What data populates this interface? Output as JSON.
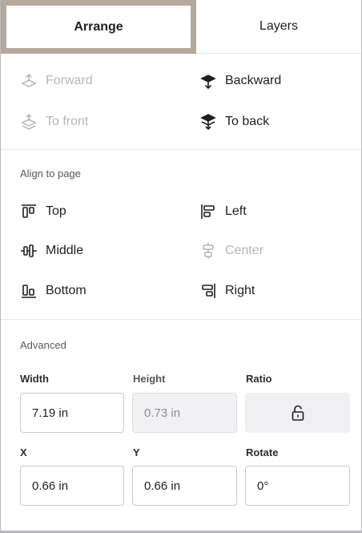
{
  "tabs": {
    "arrange": "Arrange",
    "layers": "Layers"
  },
  "layer_actions": {
    "forward": "Forward",
    "backward": "Backward",
    "to_front": "To front",
    "to_back": "To back"
  },
  "align": {
    "title": "Align to page",
    "top": "Top",
    "left": "Left",
    "middle": "Middle",
    "center": "Center",
    "bottom": "Bottom",
    "right": "Right"
  },
  "advanced": {
    "title": "Advanced",
    "width_label": "Width",
    "width_value": "7.19 in",
    "height_label": "Height",
    "height_value": "0.73 in",
    "ratio_label": "Ratio",
    "x_label": "X",
    "x_value": "0.66 in",
    "y_label": "Y",
    "y_value": "0.66 in",
    "rotate_label": "Rotate",
    "rotate_value": "0°"
  },
  "colors": {
    "active_tab_border": "#b5a89c",
    "disabled_text": "#b4b6ba"
  }
}
